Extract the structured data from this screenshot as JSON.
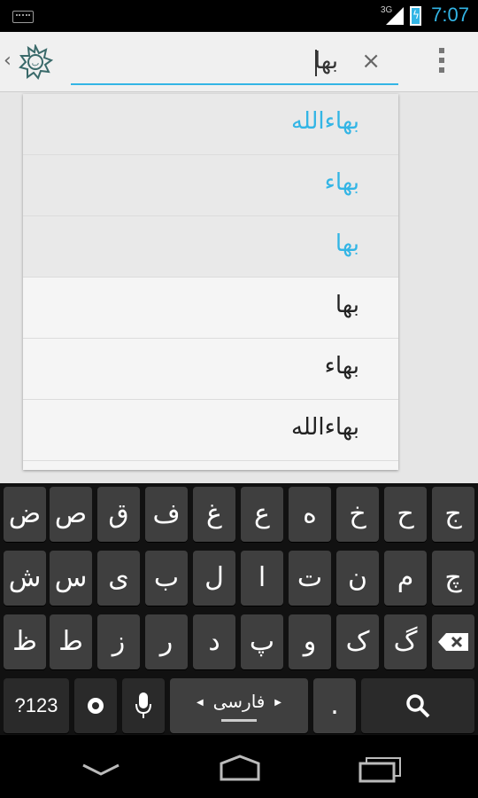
{
  "status_bar": {
    "network": "3G",
    "time": "7:07"
  },
  "search": {
    "query": "بها",
    "clear_label": "×"
  },
  "suggestions": [
    {
      "text": "بهاءالله",
      "recent": true
    },
    {
      "text": "بهاء",
      "recent": true
    },
    {
      "text": "بها",
      "recent": true
    },
    {
      "text": "بها",
      "recent": false
    },
    {
      "text": "بهاء",
      "recent": false
    },
    {
      "text": "بهاءالله",
      "recent": false
    }
  ],
  "keyboard": {
    "row1": [
      "ج",
      "ح",
      "خ",
      "ه",
      "ع",
      "غ",
      "ف",
      "ق",
      "ص",
      "ض"
    ],
    "row2": [
      "چ",
      "م",
      "ن",
      "ت",
      "ا",
      "ل",
      "ب",
      "ی",
      "س",
      "ش"
    ],
    "row3": [
      "گ",
      "ک",
      "و",
      "پ",
      "د",
      "ر",
      "ز",
      "ط",
      "ظ"
    ],
    "numbers_label": "?123",
    "language_label": "فارسی",
    "period_label": "."
  },
  "colors": {
    "accent": "#33b5e5"
  },
  "icons": [
    "keyboard-icon",
    "signal-icon",
    "battery-icon",
    "app-logo-icon",
    "close-icon",
    "overflow-menu-icon",
    "backspace-icon",
    "settings-icon",
    "microphone-icon",
    "search-icon",
    "back-icon",
    "home-icon",
    "recents-icon"
  ]
}
